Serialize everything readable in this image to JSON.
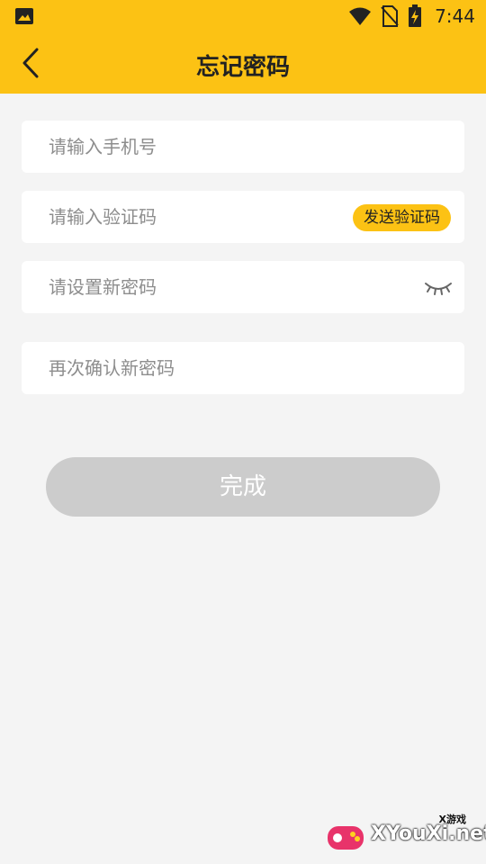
{
  "status_bar": {
    "time": "7:44"
  },
  "nav": {
    "title": "忘记密码"
  },
  "form": {
    "phone_placeholder": "请输入手机号",
    "code_placeholder": "请输入验证码",
    "send_code_label": "发送验证码",
    "new_password_placeholder": "请设置新密码",
    "confirm_password_placeholder": "再次确认新密码",
    "submit_label": "完成"
  },
  "watermark": {
    "small_text": "X游戏",
    "site_text": "XYouXi.net"
  },
  "colors": {
    "accent": "#fcc214",
    "background": "#f4f4f4",
    "disabled_button": "#cccccc"
  },
  "icons": {
    "status_left": "image-icon",
    "wifi": "wifi-icon",
    "no_sim": "no-sim-icon",
    "battery": "battery-charging-icon",
    "back": "chevron-left-icon",
    "password_visibility": "eye-closed-icon"
  }
}
